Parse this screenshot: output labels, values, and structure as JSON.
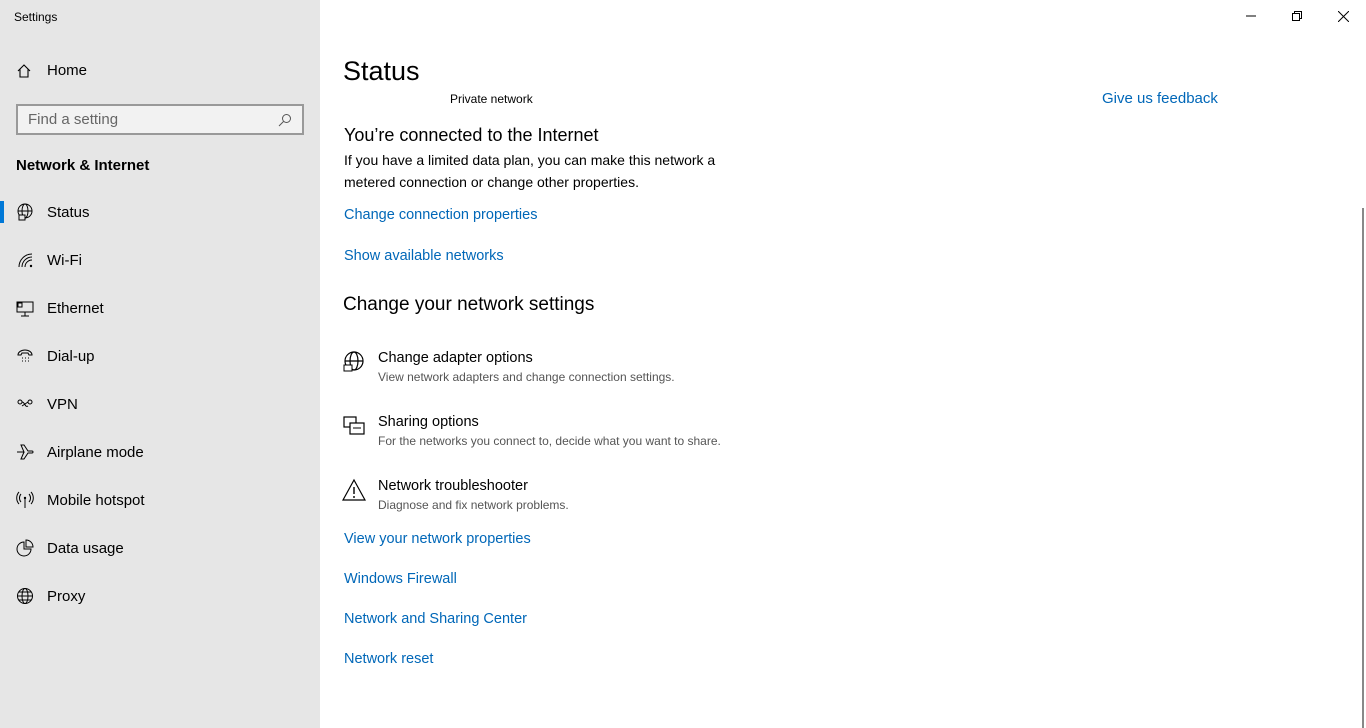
{
  "app_title": "Settings",
  "sidebar": {
    "home": "Home",
    "search_placeholder": "Find a setting",
    "section": "Network & Internet",
    "items": [
      {
        "label": "Status",
        "icon": "status-globe-icon",
        "active": true
      },
      {
        "label": "Wi-Fi",
        "icon": "wifi-icon"
      },
      {
        "label": "Ethernet",
        "icon": "ethernet-icon"
      },
      {
        "label": "Dial-up",
        "icon": "dialup-icon"
      },
      {
        "label": "VPN",
        "icon": "vpn-icon"
      },
      {
        "label": "Airplane mode",
        "icon": "airplane-icon"
      },
      {
        "label": "Mobile hotspot",
        "icon": "hotspot-icon"
      },
      {
        "label": "Data usage",
        "icon": "data-usage-icon"
      },
      {
        "label": "Proxy",
        "icon": "globe-icon"
      }
    ]
  },
  "main": {
    "title": "Status",
    "network_type": "Private network",
    "feedback": "Give us feedback",
    "connected_heading": "You’re connected to the Internet",
    "connected_text": "If you have a limited data plan, you can make this network a metered connection or change other properties.",
    "link_change_props": "Change connection properties",
    "link_show_networks": "Show available networks",
    "change_heading": "Change your network settings",
    "options": [
      {
        "title": "Change adapter options",
        "sub": "View network adapters and change connection settings.",
        "icon": "adapter-icon"
      },
      {
        "title": "Sharing options",
        "sub": "For the networks you connect to, decide what you want to share.",
        "icon": "sharing-icon"
      },
      {
        "title": "Network troubleshooter",
        "sub": "Diagnose and fix network problems.",
        "icon": "warning-icon"
      }
    ],
    "links": [
      "View your network properties",
      "Windows Firewall",
      "Network and Sharing Center",
      "Network reset"
    ]
  },
  "colors": {
    "accent": "#0078d7",
    "link": "#0067b8",
    "sidebar_bg": "#e6e6e6"
  }
}
